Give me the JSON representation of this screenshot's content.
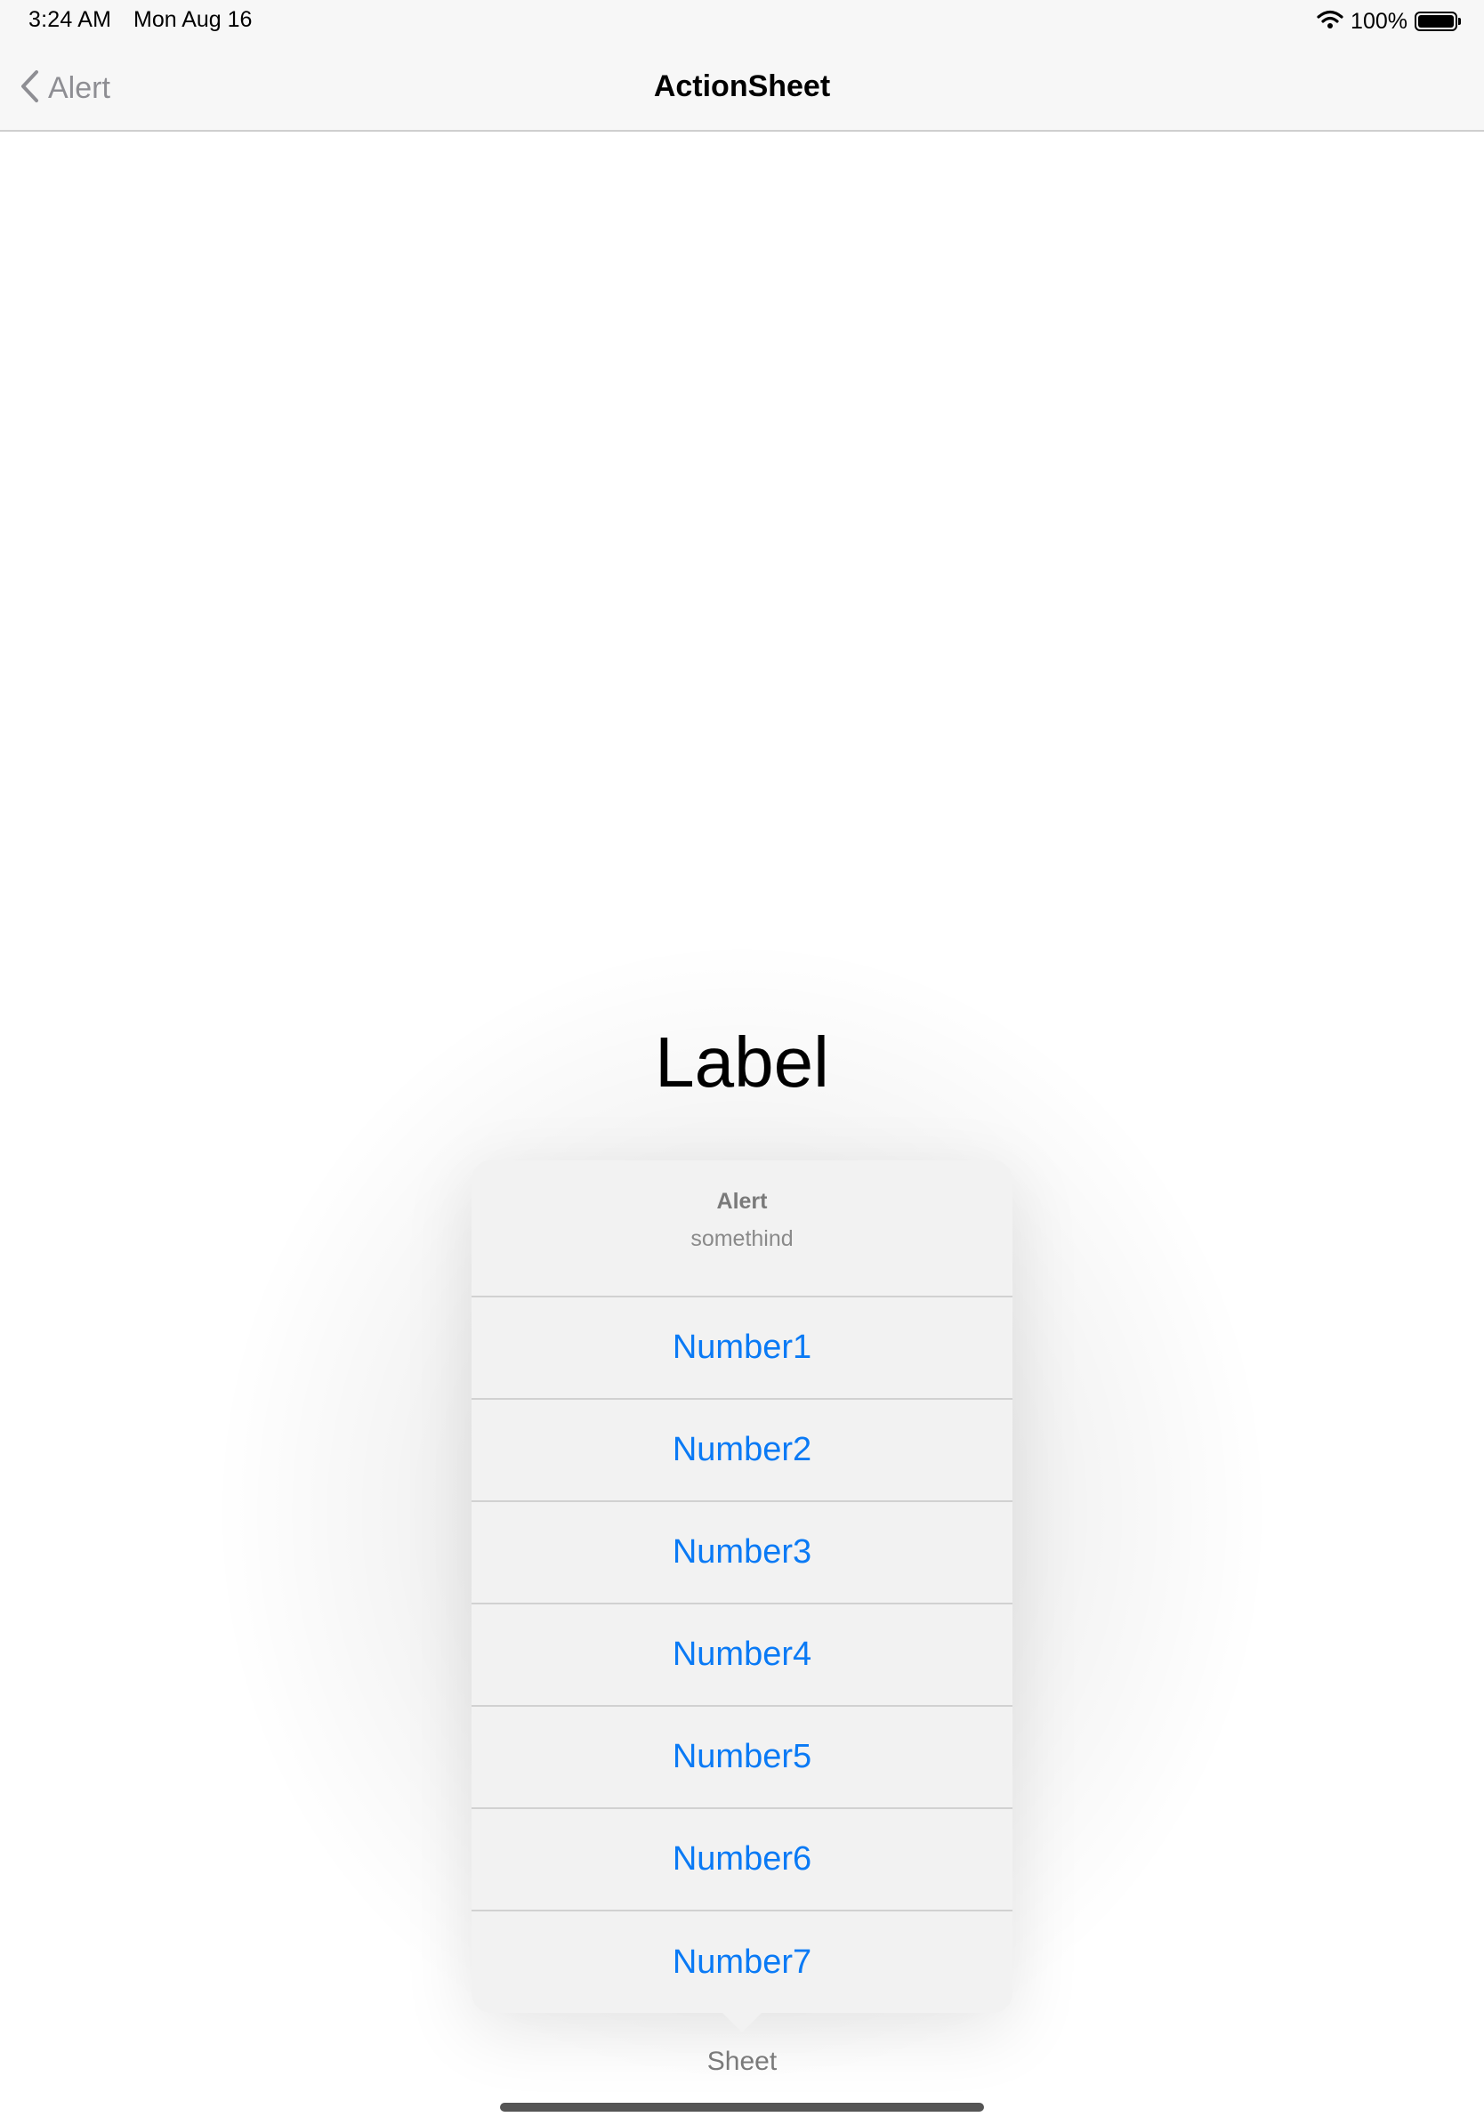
{
  "status_bar": {
    "time": "3:24 AM",
    "date": "Mon Aug 16",
    "battery_percent": "100%",
    "battery_level": 1.0
  },
  "nav": {
    "back_label": "Alert",
    "title": "ActionSheet"
  },
  "content": {
    "label": "Label",
    "source_button": "Sheet"
  },
  "action_sheet": {
    "title": "Alert",
    "message": "somethind",
    "actions": [
      "Number1",
      "Number2",
      "Number3",
      "Number4",
      "Number5",
      "Number6",
      "Number7"
    ]
  },
  "colors": {
    "accent": "#0a7af5",
    "nav_background": "#f7f7f7",
    "sheet_background": "#f2f2f2",
    "secondary_text": "#8e8e93"
  }
}
